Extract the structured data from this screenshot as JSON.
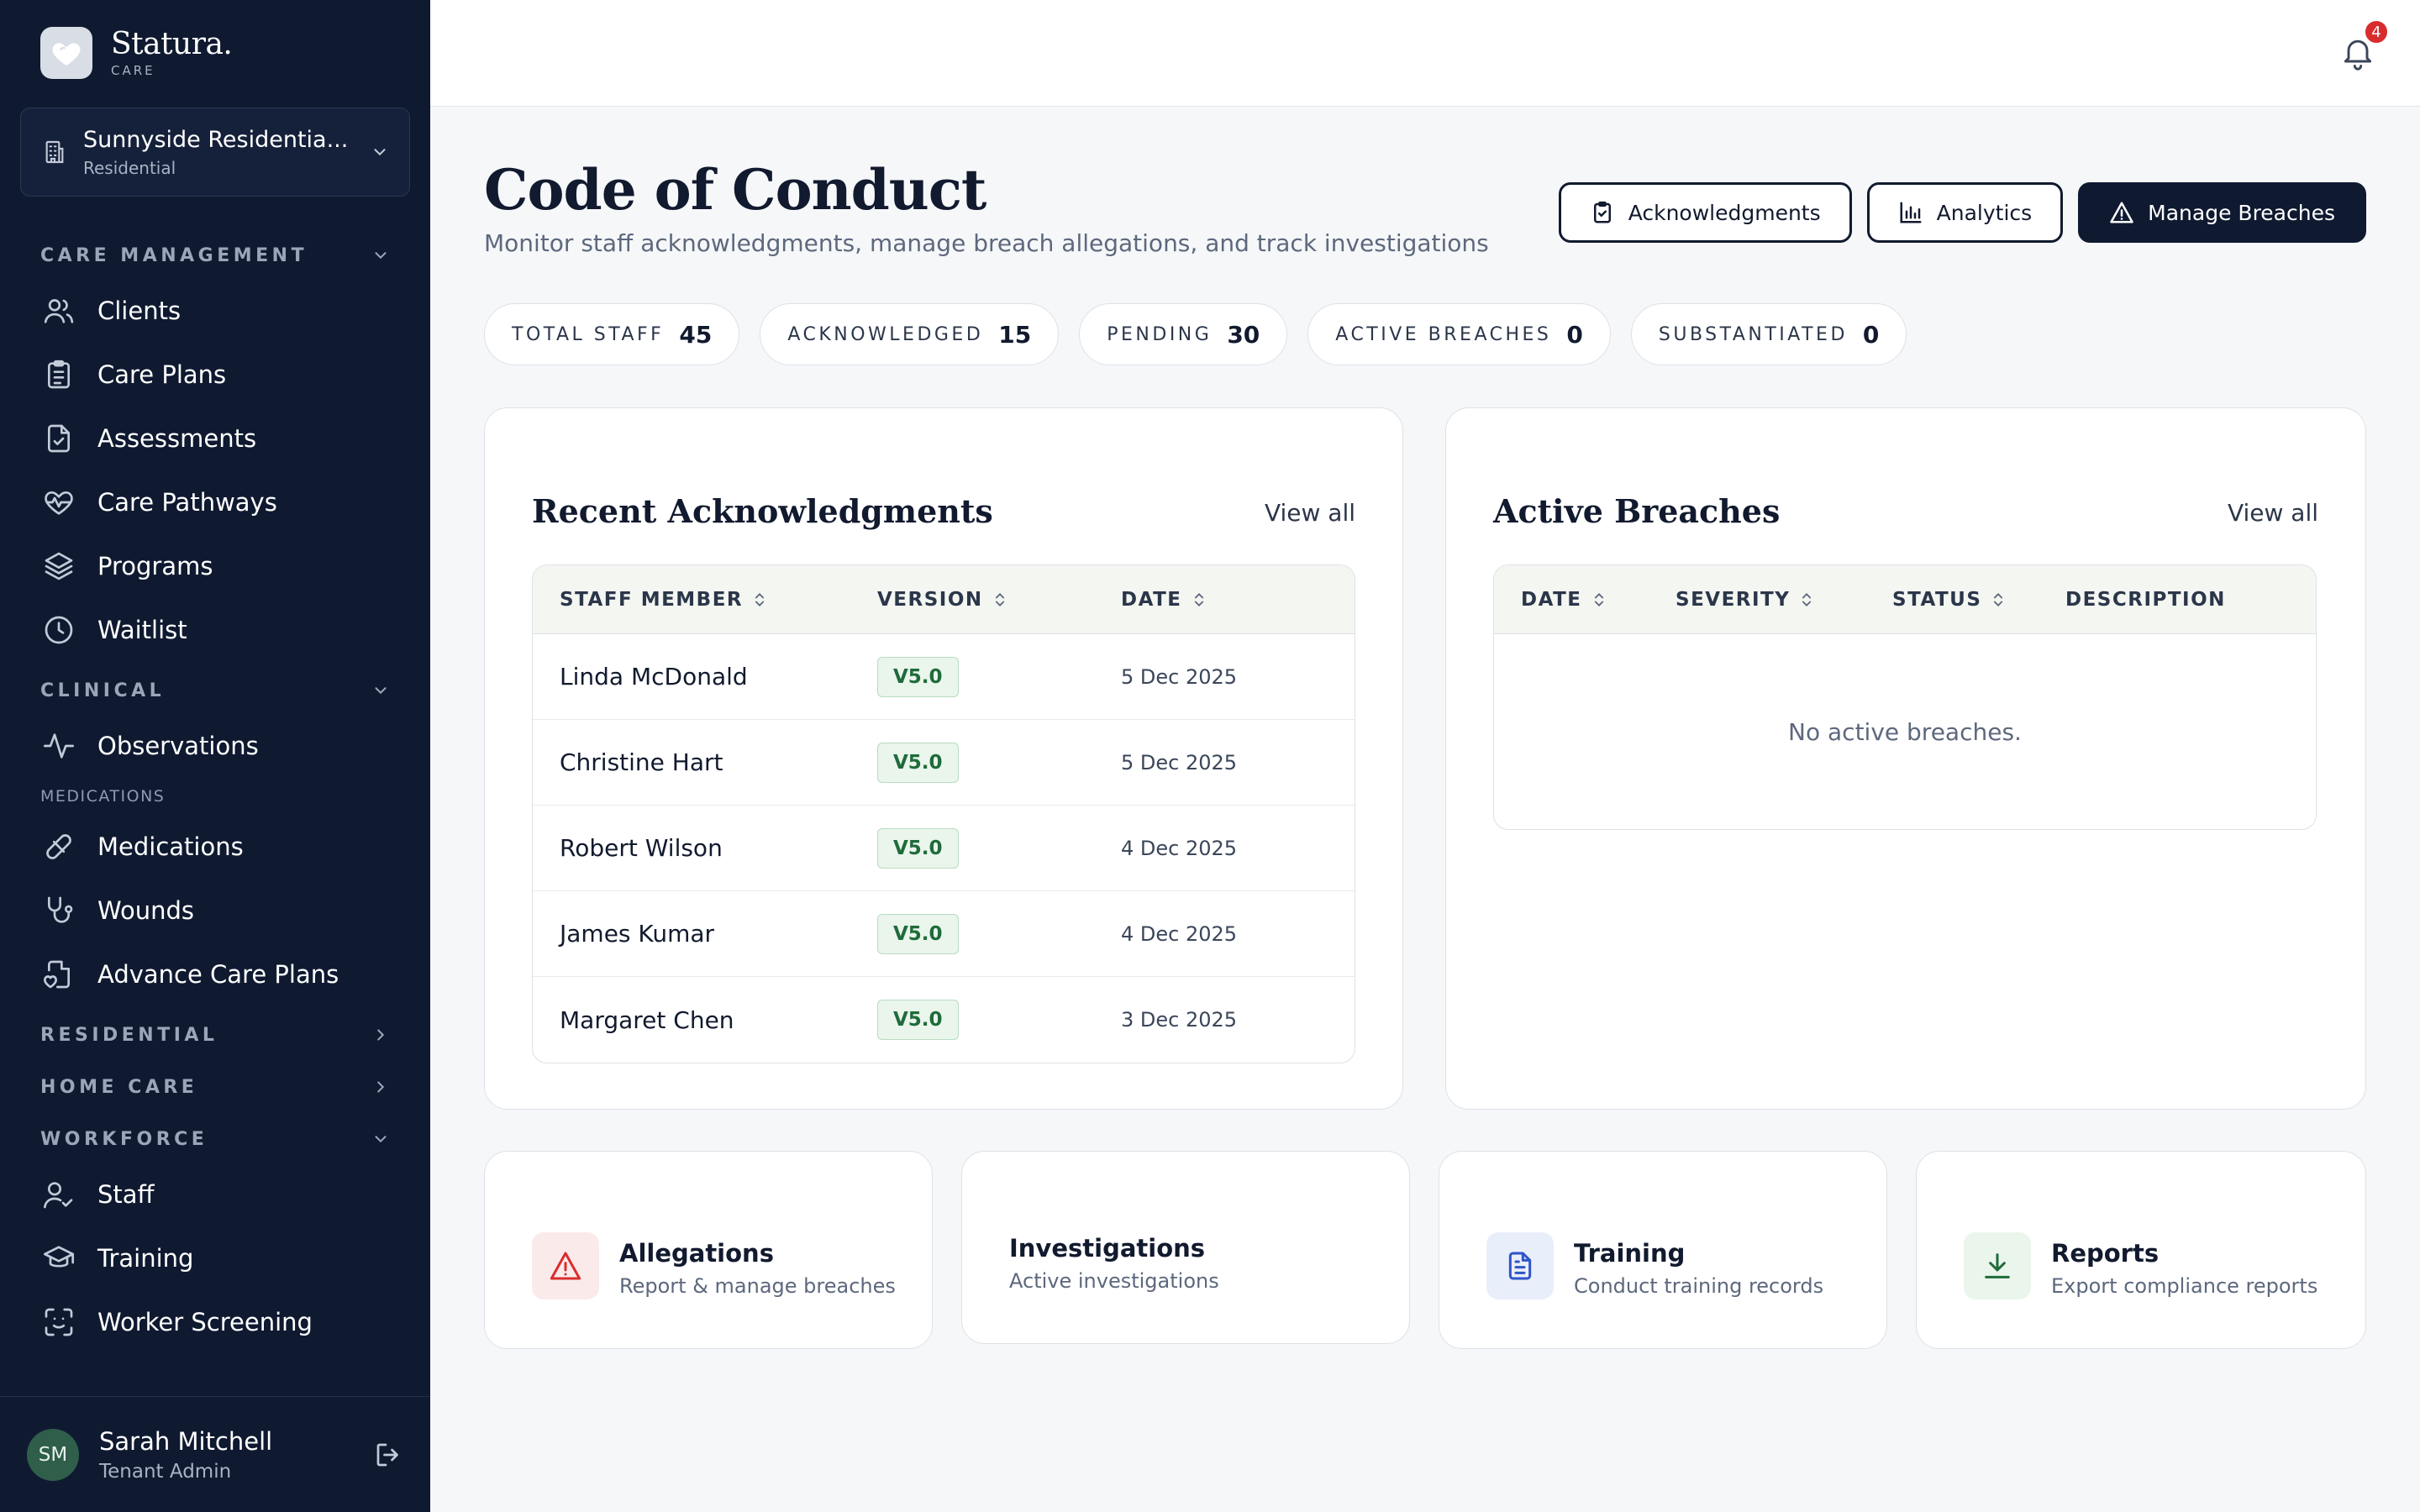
{
  "brand": {
    "name": "Statura.",
    "sub": "CARE"
  },
  "org": {
    "name": "Sunnyside Residentia...",
    "type": "Residential"
  },
  "nav": {
    "care_management": "CARE MANAGEMENT",
    "clinical": "CLINICAL",
    "medications_sub": "MEDICATIONS",
    "residential": "RESIDENTIAL",
    "home_care": "HOME CARE",
    "workforce": "WORKFORCE",
    "items": {
      "clients": "Clients",
      "care_plans": "Care Plans",
      "assessments": "Assessments",
      "care_pathways": "Care Pathways",
      "programs": "Programs",
      "waitlist": "Waitlist",
      "observations": "Observations",
      "medications": "Medications",
      "wounds": "Wounds",
      "advance_care_plans": "Advance Care Plans",
      "staff": "Staff",
      "training": "Training",
      "worker_screening": "Worker Screening"
    }
  },
  "user": {
    "initials": "SM",
    "name": "Sarah Mitchell",
    "role": "Tenant Admin"
  },
  "notifications": {
    "count": "4"
  },
  "page": {
    "title": "Code of Conduct",
    "subtitle": "Monitor staff acknowledgments, manage breach allegations, and track investigations"
  },
  "actions": {
    "acknowledgments": "Acknowledgments",
    "analytics": "Analytics",
    "manage_breaches": "Manage Breaches"
  },
  "stats": [
    {
      "label": "TOTAL STAFF",
      "value": "45"
    },
    {
      "label": "ACKNOWLEDGED",
      "value": "15"
    },
    {
      "label": "PENDING",
      "value": "30"
    },
    {
      "label": "ACTIVE BREACHES",
      "value": "0"
    },
    {
      "label": "SUBSTANTIATED",
      "value": "0"
    }
  ],
  "recent": {
    "title": "Recent Acknowledgments",
    "view_all": "View all",
    "columns": [
      "STAFF MEMBER",
      "VERSION",
      "DATE"
    ],
    "rows": [
      {
        "name": "Linda McDonald",
        "version": "V5.0",
        "date": "5 Dec 2025"
      },
      {
        "name": "Christine Hart",
        "version": "V5.0",
        "date": "5 Dec 2025"
      },
      {
        "name": "Robert Wilson",
        "version": "V5.0",
        "date": "4 Dec 2025"
      },
      {
        "name": "James Kumar",
        "version": "V5.0",
        "date": "4 Dec 2025"
      },
      {
        "name": "Margaret Chen",
        "version": "V5.0",
        "date": "3 Dec 2025"
      }
    ]
  },
  "breaches": {
    "title": "Active Breaches",
    "view_all": "View all",
    "columns": [
      "DATE",
      "SEVERITY",
      "STATUS",
      "DESCRIPTION"
    ],
    "empty": "No active breaches."
  },
  "quick": [
    {
      "title": "Allegations",
      "sub": "Report & manage breaches"
    },
    {
      "title": "Investigations",
      "sub": "Active investigations"
    },
    {
      "title": "Training",
      "sub": "Conduct training records"
    },
    {
      "title": "Reports",
      "sub": "Export compliance reports"
    }
  ],
  "colors": {
    "sidebar": "#0f1a31",
    "accent_red": "#d92d2d",
    "accent_green": "#1f6b3a",
    "accent_blue": "#2f55c7"
  }
}
